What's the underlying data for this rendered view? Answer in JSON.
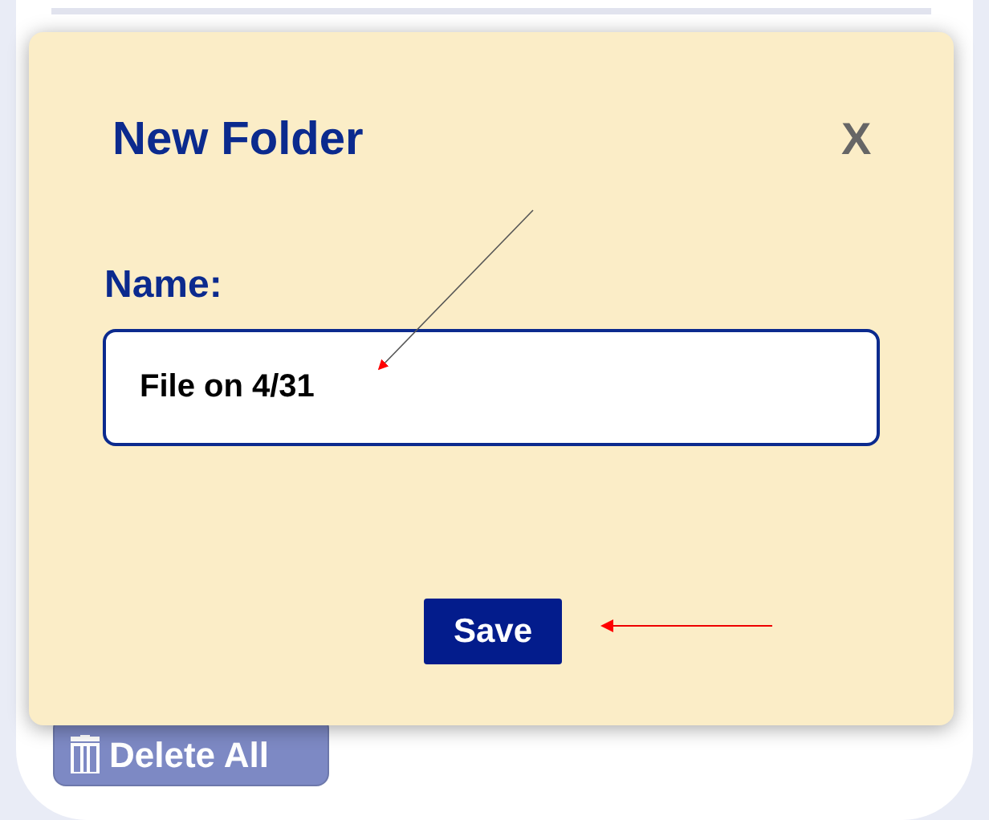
{
  "background": {
    "delete_button": "Delete All"
  },
  "dialog": {
    "title": "New Folder",
    "close": "X",
    "name_label": "Name:",
    "name_value": "File on 4/31",
    "save_button": "Save"
  }
}
